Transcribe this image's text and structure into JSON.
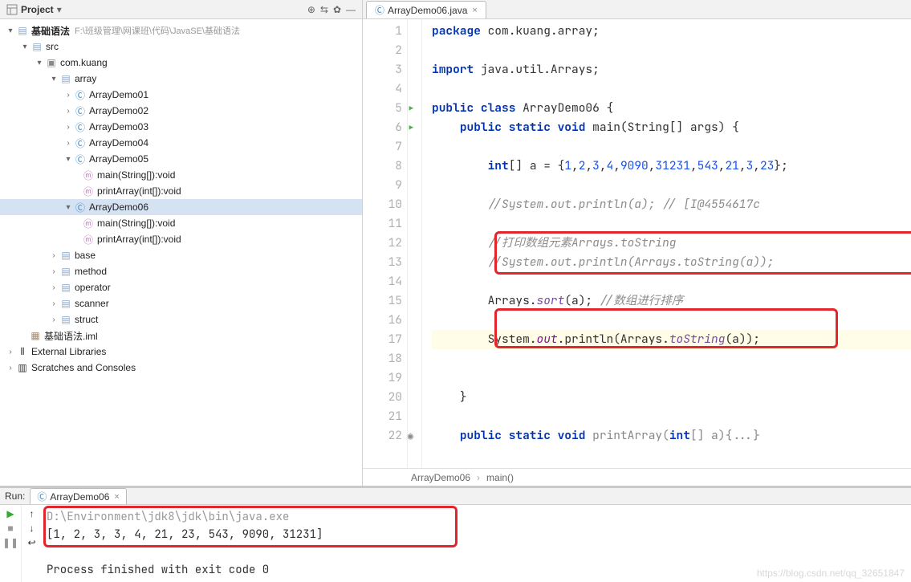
{
  "projectPanel": {
    "title": "Project",
    "rootName": "基础语法",
    "rootHint": "F:\\班级管理\\网课班\\代码\\JavaSE\\基础语法",
    "srcName": "src",
    "pkgName": "com.kuang",
    "arrayName": "array",
    "classes": [
      "ArrayDemo01",
      "ArrayDemo02",
      "ArrayDemo03",
      "ArrayDemo04",
      "ArrayDemo05",
      "ArrayDemo06"
    ],
    "methods5": [
      "main(String[]):void",
      "printArray(int[]):void"
    ],
    "methods6": [
      "main(String[]):void",
      "printArray(int[]):void"
    ],
    "otherPkgs": [
      "base",
      "method",
      "operator",
      "scanner",
      "struct"
    ],
    "imlName": "基础语法.iml",
    "extLibs": "External Libraries",
    "scratches": "Scratches and Consoles"
  },
  "editor": {
    "tabLabel": "ArrayDemo06.java",
    "lines": {
      "l1a": "package",
      "l1b": " com.kuang.array;",
      "l3a": "import",
      "l3b": " java.util.Arrays;",
      "l5a": "public class",
      "l5b": " ArrayDemo06 {",
      "l6a": "public static void",
      "l6b": " main(String[] args) {",
      "l8a": "int",
      "l8b": "[] a = {",
      "l8c": "1",
      "l8d": ",",
      "l8e": "2",
      "l8f": ",",
      "l8g": "3",
      "l8h": ",",
      "l8i": "4",
      "l8j": ",",
      "l8k": "9090",
      "l8l": ",",
      "l8m": "31231",
      "l8n": ",",
      "l8o": "543",
      "l8p": ",",
      "l8q": "21",
      "l8r": ",",
      "l8s": "3",
      "l8t": ",",
      "l8u": "23",
      "l8v": "};",
      "l10": "//System.out.println(a); // [I@4554617c",
      "l12": "//打印数组元素Arrays.toString",
      "l13": "//System.out.println(Arrays.toString(a));",
      "l15a": "Arrays.",
      "l15b": "sort",
      "l15c": "(a); ",
      "l15d": "//数组进行排序",
      "l17a": "System.",
      "l17b": "out",
      "l17c": ".println(Arrays.",
      "l17d": "toString",
      "l17e": "(a));",
      "l20": "}",
      "l22a": "public static void",
      "l22b": " printArray(",
      "l22c": "int",
      "l22d": "[] a)",
      "l22e": "{...}"
    },
    "breadcrumb": [
      "ArrayDemo06",
      "main()"
    ]
  },
  "run": {
    "title": "Run:",
    "tabLabel": "ArrayDemo06",
    "line1": "D:\\Environment\\jdk8\\jdk\\bin\\java.exe",
    "line2": "[1, 2, 3, 3, 4, 21, 23, 543, 9090, 31231]",
    "line4": "Process finished with exit code 0"
  },
  "watermark": "https://blog.csdn.net/qq_32651847"
}
